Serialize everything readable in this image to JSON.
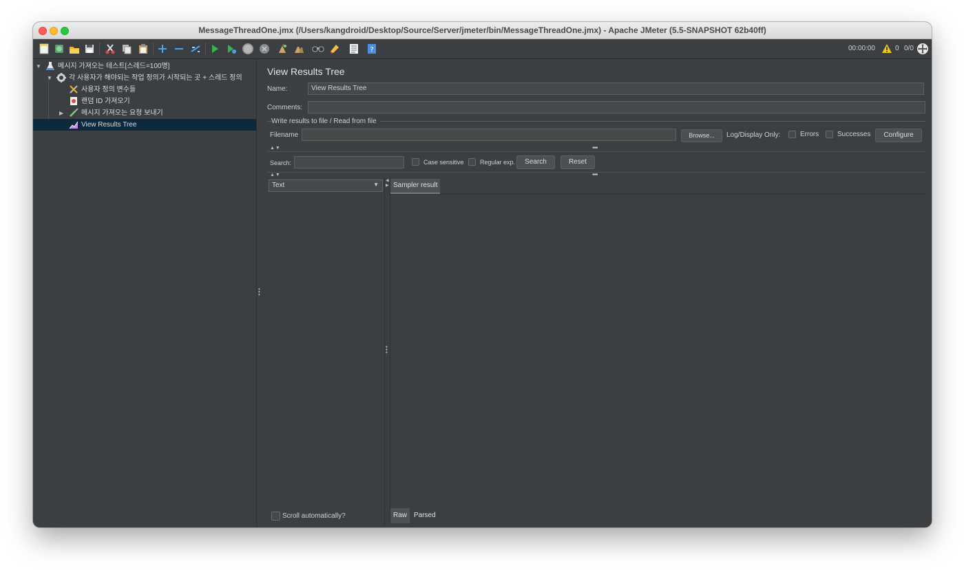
{
  "window": {
    "title": "MessageThreadOne.jmx (/Users/kangdroid/Desktop/Source/Server/jmeter/bin/MessageThreadOne.jmx) - Apache JMeter (5.5-SNAPSHOT 62b40ff)"
  },
  "toolbar": {
    "timer": "00:00:00",
    "warning_count": "0",
    "thread_ratio": "0/0",
    "icons": [
      "new-icon",
      "templates-icon",
      "open-icon",
      "save-icon",
      "cut-icon",
      "copy-icon",
      "paste-icon",
      "expand-icon",
      "collapse-icon",
      "toggle-icon",
      "start-icon",
      "start-no-pauses-icon",
      "stop-icon",
      "shutdown-icon",
      "clear-icon",
      "clear-all-icon",
      "search-icon",
      "reset-search-icon",
      "function-helper-icon",
      "help-icon",
      "warning-icon",
      "remote-icon"
    ]
  },
  "tree": {
    "items": [
      {
        "label": "메시지 가져오는 테스트[스레드=100명]"
      },
      {
        "label": "각 사용자가 해야되는 작업 정의가 시작되는 곳 + 스레드 정의"
      },
      {
        "label": "사용자 정의 변수들"
      },
      {
        "label": "랜덤 ID 가져오기"
      },
      {
        "label": "메시지 가져오는 요청 보내기"
      },
      {
        "label": "View Results Tree"
      }
    ]
  },
  "panel": {
    "title": "View Results Tree",
    "name_label": "Name:",
    "name_value": "View Results Tree",
    "comments_label": "Comments:",
    "comments_value": "",
    "file_group_title": "Write results to file / Read from file",
    "filename_label": "Filename",
    "filename_value": "",
    "browse_label": "Browse...",
    "log_display_label": "Log/Display Only:",
    "errors_label": "Errors",
    "successes_label": "Successes",
    "configure_label": "Configure",
    "search_label": "Search:",
    "search_value": "",
    "case_sensitive_label": "Case sensitive",
    "regular_exp_label": "Regular exp.",
    "search_button": "Search",
    "reset_button": "Reset",
    "renderer_selected": "Text",
    "sampler_result_tab": "Sampler result",
    "scroll_auto_label": "Scroll automatically?",
    "raw_tab": "Raw",
    "parsed_tab": "Parsed"
  }
}
